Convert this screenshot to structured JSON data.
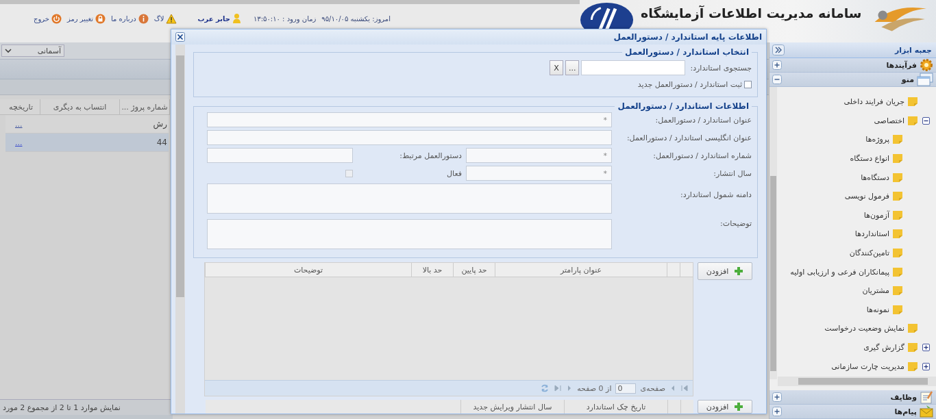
{
  "header": {
    "title": "سامانه مدیریت اطلاعات آزمایشگاه"
  },
  "top_links": [
    {
      "kind": "date",
      "text": "امروز: یکشنبه ۹۵/۱۰/۰۵"
    },
    {
      "kind": "time",
      "text": "زمان ورود : ۱۳:۵۰:۱۰"
    },
    {
      "kind": "user",
      "text": "جابر عرب"
    },
    {
      "kind": "log",
      "text": "لاگ"
    },
    {
      "kind": "about",
      "text": "درباره ما"
    },
    {
      "kind": "password",
      "text": "تغییر رمز"
    },
    {
      "kind": "logout",
      "text": "خروج"
    }
  ],
  "left_panel": {
    "theme_select": {
      "value": "آسمانی"
    },
    "columns": [
      "شماره پروژ ...",
      "انتساب به دیگری",
      "تاریخچه"
    ],
    "rows": [
      {
        "cell": "رش",
        "link": "...",
        "selected": false
      },
      {
        "cell": "44",
        "link": "...",
        "selected": true
      }
    ],
    "status": "نمایش موارد 1 تا 2 از مجموع 2 مورد"
  },
  "dialog": {
    "title": "اطلاعات پایه استاندارد / دستورالعمل",
    "select_section": {
      "legend": "انتخاب استاندارد / دستورالعمل",
      "search_label": "جستجوی استاندارد:",
      "browse_button": "...",
      "clear_button": "X",
      "new_checkbox": {
        "label": "ثبت استاندارد / دستورالعمل جدید",
        "checked": false
      }
    },
    "info_section": {
      "legend": "اطلاعات استاندارد / دستورالعمل",
      "fields": [
        {
          "kind": "wide",
          "label": "عنوان استاندارد / دستورالعمل:",
          "placeholder": "*"
        },
        {
          "kind": "wide",
          "label": "عنوان انگلیسی استاندارد / دستورالعمل:"
        },
        {
          "kind": "pair",
          "label": "شماره استاندارد / دستورالعمل:",
          "placeholder": "*",
          "second_label": "دستورالعمل مرتبط:"
        },
        {
          "kind": "check",
          "label": "سال انتشار:",
          "placeholder": "*",
          "check": {
            "label": "فعال",
            "checked": false,
            "disabled": true
          }
        },
        {
          "kind": "area",
          "label": "دامنه شمول استاندارد:"
        },
        {
          "kind": "area",
          "label": "توضیحات:"
        }
      ]
    },
    "parameters": {
      "add_button": "افزودن",
      "columns": [
        "عنوان پارامتر",
        "حد پایین",
        "حد بالا",
        "توضیحات"
      ],
      "pager": {
        "page_label": "صفحه‌ی",
        "page": "0",
        "of_label": "از 0 صفحه"
      }
    },
    "history": {
      "add_button": "افزودن",
      "columns": [
        "تاریخ چک استاندارد",
        "سال انتشار ویرایش جدید"
      ]
    }
  },
  "sidebar": {
    "title": "جعبه ابزار",
    "panels": [
      {
        "kind": "processes",
        "label": "فرآیندها",
        "expanded": false
      },
      {
        "kind": "menu",
        "label": "منو",
        "expanded": true,
        "tree": [
          {
            "label": "جریان فرایند داخلی"
          },
          {
            "label": "اختصاصی",
            "expanded": true,
            "children": [
              {
                "label": "پروژه‌ها"
              },
              {
                "label": "انواع دستگاه"
              },
              {
                "label": "دستگاه‌ها"
              },
              {
                "label": "فرمول نویسی"
              },
              {
                "label": "آزمون‌ها"
              },
              {
                "label": "استانداردها"
              },
              {
                "label": "تامین‌کنندگان"
              },
              {
                "label": "پیمانکاران فرعی و ارزیابی اولیه"
              },
              {
                "label": "مشتریان"
              },
              {
                "label": "نمونه‌ها"
              }
            ]
          },
          {
            "label": "نمایش وضعیت درخواست"
          },
          {
            "label": "گزارش گیری",
            "expanded": false
          },
          {
            "label": "مدیریت چارت سازمانی",
            "expanded": false
          }
        ]
      },
      {
        "kind": "tasks",
        "label": "وظایف",
        "expanded": false
      },
      {
        "kind": "messages",
        "label": "پیام‌ها",
        "expanded": false
      }
    ]
  }
}
